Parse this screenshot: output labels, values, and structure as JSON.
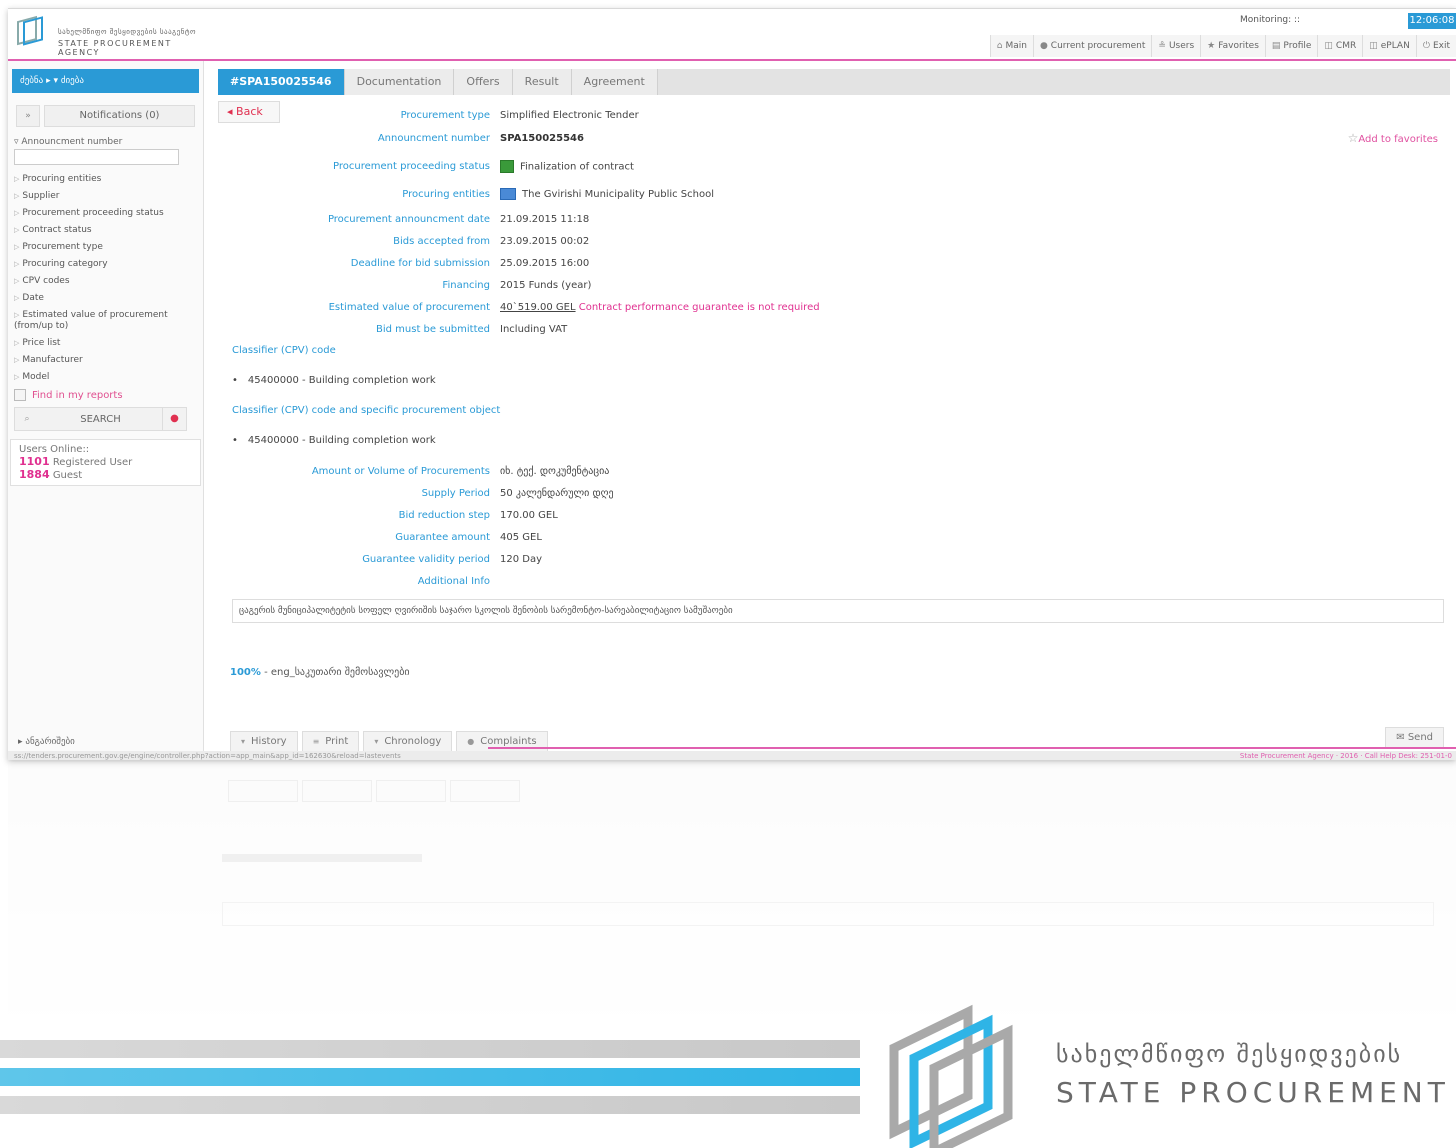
{
  "header": {
    "logo_geo": "სახელმწიფო შესყიდვების სააგენტო",
    "logo_en": "STATE PROCUREMENT AGENCY",
    "monitoring_label": "Monitoring: ::",
    "clock": "12:06:08",
    "nav": [
      {
        "icon": "⌂",
        "label": "Main"
      },
      {
        "icon": "●",
        "label": "Current procurement"
      },
      {
        "icon": "≗",
        "label": "Users"
      },
      {
        "icon": "★",
        "label": "Favorites"
      },
      {
        "icon": "▤",
        "label": "Profile"
      },
      {
        "icon": "◫",
        "label": "CMR"
      },
      {
        "icon": "◫",
        "label": "ePLAN"
      },
      {
        "icon": "⏻",
        "label": "Exit"
      }
    ]
  },
  "sidebar": {
    "head": "ძებნა ▸ ▾ ძიება",
    "notifications": "Notifications (0)",
    "announcement_label": "Announcment number",
    "filters": [
      "Procuring entities",
      "Supplier",
      "Procurement proceeding status",
      "Contract status",
      "Procurement type",
      "Procuring category",
      "CPV codes",
      "Date",
      "Estimated value of procurement (from/up to)",
      "Price list",
      "Manufacturer",
      "Model"
    ],
    "find_in_reports": "Find in my reports",
    "search": "SEARCH",
    "users_online": "Users Online::",
    "registered_count": "1101",
    "registered_label": "Registered User",
    "guest_count": "1884",
    "guest_label": "Guest",
    "bottom": "ანგარიშები"
  },
  "tabs": [
    "#SPA150025546",
    "Documentation",
    "Offers",
    "Result",
    "Agreement"
  ],
  "back": "Back",
  "add_to_favorites": "Add to favorites",
  "details": [
    {
      "label": "Procurement type",
      "value": "Simplified Electronic Tender"
    },
    {
      "label": "Announcment number",
      "value": "SPA150025546"
    },
    {
      "label": "Procurement proceeding status",
      "value": "Finalization of contract"
    },
    {
      "label": "Procuring entities",
      "value": "The Gvirishi Municipality Public School"
    },
    {
      "label": "Procurement announcment date",
      "value": "21.09.2015 11:18"
    },
    {
      "label": "Bids accepted from",
      "value": "23.09.2015 00:02"
    },
    {
      "label": "Deadline for bid submission",
      "value": "25.09.2015 16:00"
    },
    {
      "label": "Financing",
      "value": "2015 Funds (year)"
    },
    {
      "label": "Estimated value of procurement",
      "value": "40`519.00 GEL",
      "note": "Contract performance guarantee is not required"
    },
    {
      "label": "Bid must be submitted",
      "value": "Including VAT"
    }
  ],
  "cpv": {
    "title1": "Classifier (CPV) code",
    "item1": "45400000 - Building completion work",
    "title2": "Classifier (CPV) code and specific procurement object",
    "item2": "45400000 - Building completion work"
  },
  "details2": [
    {
      "label": "Amount or Volume of Procurements",
      "value": "იხ. ტექ. დოკუმენტაცია"
    },
    {
      "label": "Supply Period",
      "value": "50 კალენდარული დღე"
    },
    {
      "label": "Bid reduction step",
      "value": "170.00 GEL"
    },
    {
      "label": "Guarantee amount",
      "value": "405 GEL"
    },
    {
      "label": "Guarantee validity period",
      "value": "120 Day"
    },
    {
      "label": "Additional Info",
      "value": ""
    }
  ],
  "additional_info": "ცაგერის მუნიციპალიტეტის სოფელ ღვირიშის საჯარო სკოლის შენობის სარემონტო-სარეაბილიტაციო სამუშაოები",
  "progress_pct": "100%",
  "progress_text": " - eng_საკუთარი შემოსავლები",
  "bottom_buttons": [
    {
      "icon": "▾",
      "label": "History"
    },
    {
      "icon": "≡",
      "label": "Print"
    },
    {
      "icon": "▾",
      "label": "Chronology"
    },
    {
      "icon": "●",
      "label": "Complaints"
    }
  ],
  "send": "Send",
  "statusbar": "ss://tenders.procurement.gov.ge/engine/controller.php?action=app_main&app_id=162630&reload=lastevents",
  "footer_right": "State Procurement Agency · 2016 · Call Help Desk: 251-01-0",
  "brand_geo": "სახელმწიფო შესყიდვების",
  "brand_en": "STATE PROCUREMENT"
}
